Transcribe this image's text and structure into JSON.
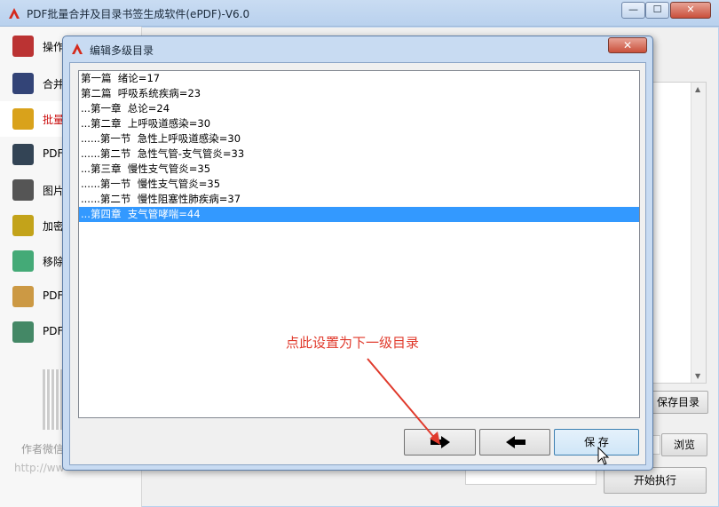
{
  "main_window": {
    "title": "PDF批量合并及目录书签生成软件(ePDF)-V6.0",
    "controls": {
      "minimize": "—",
      "maximize": "☐",
      "close": "✕"
    }
  },
  "sidebar": {
    "items": [
      {
        "label": "操作",
        "icon": "operation-icon",
        "color": "#b33"
      },
      {
        "label": "合并",
        "icon": "merge-icon",
        "color": "#347"
      },
      {
        "label": "批量",
        "icon": "folder-icon",
        "color": "#d9a21b",
        "active": true
      },
      {
        "label": "PDF",
        "icon": "pdf-icon",
        "color": "#345"
      },
      {
        "label": "图片",
        "icon": "image-icon",
        "color": "#555"
      },
      {
        "label": "加密",
        "icon": "encrypt-icon",
        "color": "#c3a31a"
      },
      {
        "label": "移除",
        "icon": "remove-icon",
        "color": "#4a7"
      },
      {
        "label": "PDF",
        "icon": "pdf-lock-icon",
        "color": "#c94"
      },
      {
        "label": "PDF",
        "icon": "key-icon",
        "color": "#486"
      }
    ],
    "footer_author": "作者微信",
    "footer_url": "http://ww"
  },
  "background": {
    "save_toc_button": "保存目录",
    "browse_button": "浏览",
    "start_button": "开始执行"
  },
  "dialog": {
    "title": "编辑多级目录",
    "close": "✕",
    "toc_items": [
      {
        "text": "第一篇  绪论=17",
        "selected": false
      },
      {
        "text": "第二篇  呼吸系统疾病=23",
        "selected": false
      },
      {
        "text": "...第一章  总论=24",
        "selected": false
      },
      {
        "text": "...第二章  上呼吸道感染=30",
        "selected": false
      },
      {
        "text": "......第一节  急性上呼吸道感染=30",
        "selected": false
      },
      {
        "text": "......第二节  急性气管-支气管炎=33",
        "selected": false
      },
      {
        "text": "...第三章  慢性支气管炎=35",
        "selected": false
      },
      {
        "text": "......第一节  慢性支气管炎=35",
        "selected": false
      },
      {
        "text": "......第二节  慢性阻塞性肺疾病=37",
        "selected": false
      },
      {
        "text": "...第四章  支气管哮喘=44",
        "selected": true
      }
    ],
    "save_button": "保 存"
  },
  "annotation": {
    "text": "点此设置为下一级目录",
    "color": "#e0392b"
  }
}
